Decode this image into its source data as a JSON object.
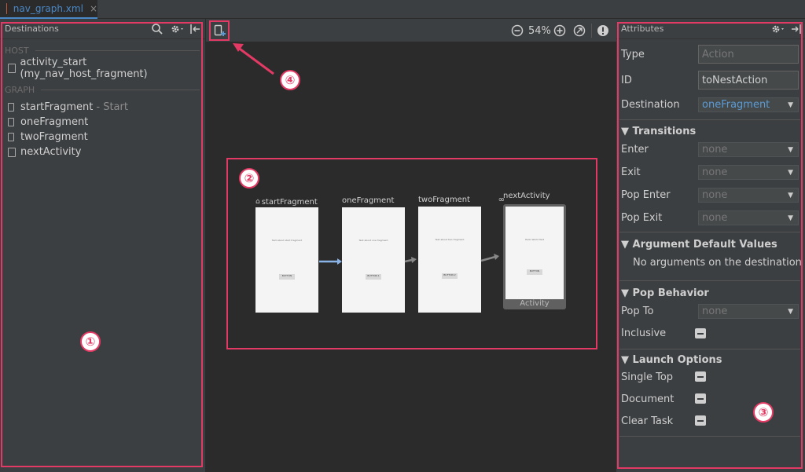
{
  "tab": {
    "file_name": "nav_graph.xml",
    "close_glyph": "×"
  },
  "left": {
    "title": "Destinations",
    "host_header": "HOST",
    "host_item": "activity_start (my_nav_host_fragment)",
    "graph_header": "GRAPH",
    "items": [
      {
        "label": "startFragment",
        "sub": "- Start",
        "icon": "document-icon"
      },
      {
        "label": "oneFragment",
        "sub": "",
        "icon": "document-icon"
      },
      {
        "label": "twoFragment",
        "sub": "",
        "icon": "document-icon"
      },
      {
        "label": "nextActivity",
        "sub": "",
        "icon": "activity-icon"
      }
    ]
  },
  "toolbar": {
    "zoom": "54%"
  },
  "graph": {
    "fragments": [
      {
        "label": "startFragment",
        "text": "Text about start fragment",
        "button": "BUTTON"
      },
      {
        "label": "oneFragment",
        "text": "Text about one fragment",
        "button": "BUTTON 1"
      },
      {
        "label": "twoFragment",
        "text": "Text about two fragment",
        "button": "BUTTON 2"
      },
      {
        "label": "nextActivity",
        "text": "Hello World Text",
        "button": "BUTTON",
        "footer": "Activity"
      }
    ],
    "self_loop_glyph": "∞"
  },
  "right": {
    "title": "Attributes",
    "type_label": "Type",
    "type_placeholder": "Action",
    "id_label": "ID",
    "id_value": "toNestAction",
    "dest_label": "Destination",
    "dest_value": "oneFragment",
    "transitions_title": "Transitions",
    "enter_label": "Enter",
    "exit_label": "Exit",
    "pop_enter_label": "Pop Enter",
    "pop_exit_label": "Pop Exit",
    "none": "none",
    "arg_title": "Argument Default Values",
    "arg_empty": "No arguments on the destination",
    "pop_title": "Pop Behavior",
    "pop_to_label": "Pop To",
    "inclusive_label": "Inclusive",
    "launch_title": "Launch Options",
    "single_top_label": "Single Top",
    "document_label": "Document",
    "clear_task_label": "Clear Task"
  },
  "annotations": {
    "n1": "①",
    "n2": "②",
    "n3": "③",
    "n4": "④"
  },
  "colors": {
    "highlight": "#e23a64",
    "accent": "#4a88c7",
    "panel": "#3c3f41",
    "canvas": "#2b2b2b"
  }
}
